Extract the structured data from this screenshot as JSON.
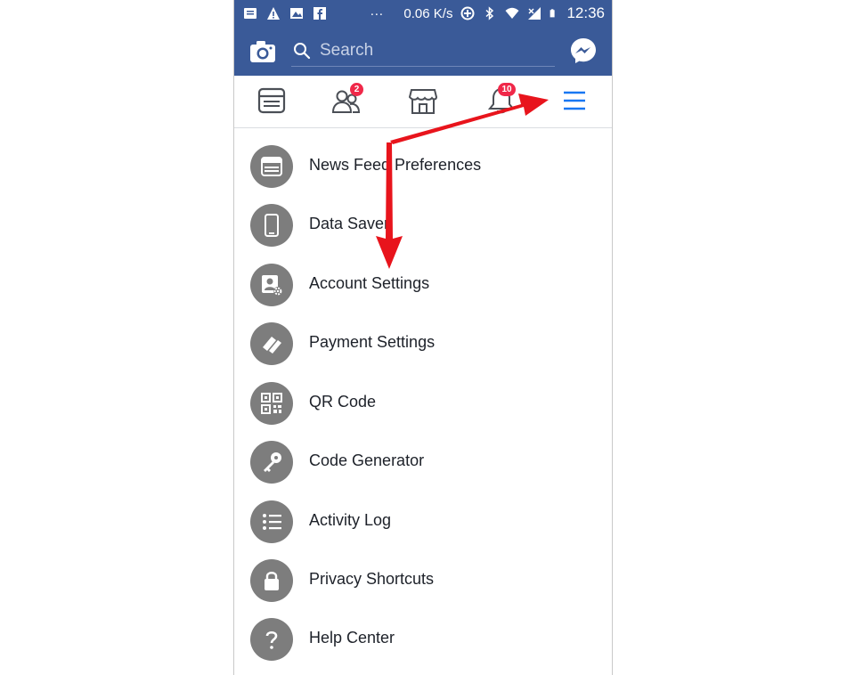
{
  "status_bar": {
    "speed": "0.06 K/s",
    "time": "12:36",
    "dots": "···"
  },
  "top_bar": {
    "search_placeholder": "Search"
  },
  "nav": {
    "friends_badge": "2",
    "notifications_badge": "10"
  },
  "menu": {
    "items": [
      {
        "label": "News Feed Preferences",
        "icon": "news-feed-icon"
      },
      {
        "label": "Data Saver",
        "icon": "phone-icon"
      },
      {
        "label": "Account Settings",
        "icon": "account-settings-icon"
      },
      {
        "label": "Payment Settings",
        "icon": "payment-icon"
      },
      {
        "label": "QR Code",
        "icon": "qr-code-icon"
      },
      {
        "label": "Code Generator",
        "icon": "key-icon"
      },
      {
        "label": "Activity Log",
        "icon": "list-icon"
      },
      {
        "label": "Privacy Shortcuts",
        "icon": "lock-icon"
      },
      {
        "label": "Help Center",
        "icon": "help-icon"
      }
    ]
  },
  "colors": {
    "brand": "#3a5a98",
    "accent": "#1877f2",
    "badge": "#f02849",
    "arrow": "#e8141c",
    "icon_circle": "#7d7d7d"
  }
}
